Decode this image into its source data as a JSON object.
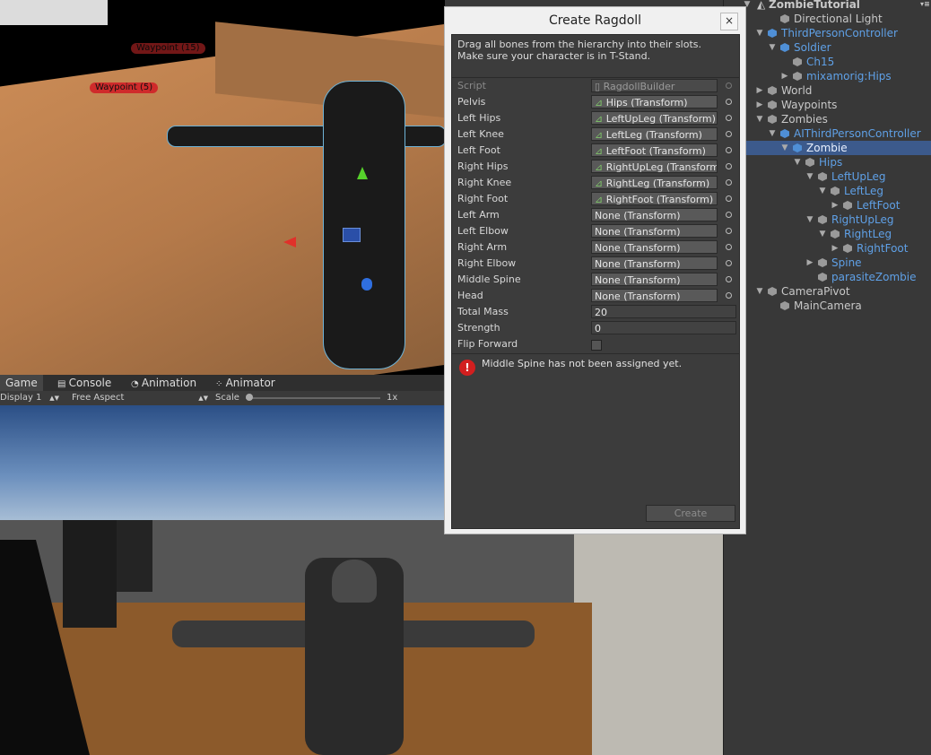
{
  "scene": {
    "waypoints": [
      "Waypoint (15)",
      "Waypoint (5)"
    ]
  },
  "tabs": [
    {
      "label": "Game",
      "icon": "game-icon"
    },
    {
      "label": "Console",
      "icon": "console-icon"
    },
    {
      "label": "Animation",
      "icon": "animation-icon"
    },
    {
      "label": "Animator",
      "icon": "animator-icon"
    }
  ],
  "game_toolbar": {
    "display": "Display 1",
    "aspect": "Free Aspect",
    "scale_label": "Scale",
    "scale_value": "1x"
  },
  "dialog": {
    "title": "Create Ragdoll",
    "close": "×",
    "instructions_line1": "Drag all bones from the hierarchy into their slots.",
    "instructions_line2": "Make sure your character is in T-Stand.",
    "script_label": "Script",
    "script_value": "RagdollBuilder",
    "fields": [
      {
        "label": "Pelvis",
        "value": "Hips (Transform)"
      },
      {
        "label": "Left Hips",
        "value": "LeftUpLeg (Transform)"
      },
      {
        "label": "Left Knee",
        "value": "LeftLeg (Transform)"
      },
      {
        "label": "Left Foot",
        "value": "LeftFoot (Transform)"
      },
      {
        "label": "Right Hips",
        "value": "RightUpLeg (Transform)"
      },
      {
        "label": "Right Knee",
        "value": "RightLeg (Transform)"
      },
      {
        "label": "Right Foot",
        "value": "RightFoot (Transform)"
      },
      {
        "label": "Left Arm",
        "value": "None (Transform)"
      },
      {
        "label": "Left Elbow",
        "value": "None (Transform)"
      },
      {
        "label": "Right Arm",
        "value": "None (Transform)"
      },
      {
        "label": "Right Elbow",
        "value": "None (Transform)"
      },
      {
        "label": "Middle Spine",
        "value": "None (Transform)"
      },
      {
        "label": "Head",
        "value": "None (Transform)"
      }
    ],
    "total_mass_label": "Total Mass",
    "total_mass": "20",
    "strength_label": "Strength",
    "strength": "0",
    "flip_forward_label": "Flip Forward",
    "warning": "Middle Spine has not been assigned yet.",
    "create_button": "Create"
  },
  "hierarchy": {
    "scene_name": "ZombieTutorial",
    "items": [
      {
        "label": "Directional Light"
      },
      {
        "label": "ThirdPersonController"
      },
      {
        "label": "Soldier"
      },
      {
        "label": "Ch15"
      },
      {
        "label": "mixamorig:Hips"
      },
      {
        "label": "World"
      },
      {
        "label": "Waypoints"
      },
      {
        "label": "Zombies"
      },
      {
        "label": "AIThirdPersonController"
      },
      {
        "label": "Zombie"
      },
      {
        "label": "Hips"
      },
      {
        "label": "LeftUpLeg"
      },
      {
        "label": "LeftLeg"
      },
      {
        "label": "LeftFoot"
      },
      {
        "label": "RightUpLeg"
      },
      {
        "label": "RightLeg"
      },
      {
        "label": "RightFoot"
      },
      {
        "label": "Spine"
      },
      {
        "label": "parasiteZombie"
      },
      {
        "label": "CameraPivot"
      },
      {
        "label": "MainCamera"
      }
    ]
  }
}
